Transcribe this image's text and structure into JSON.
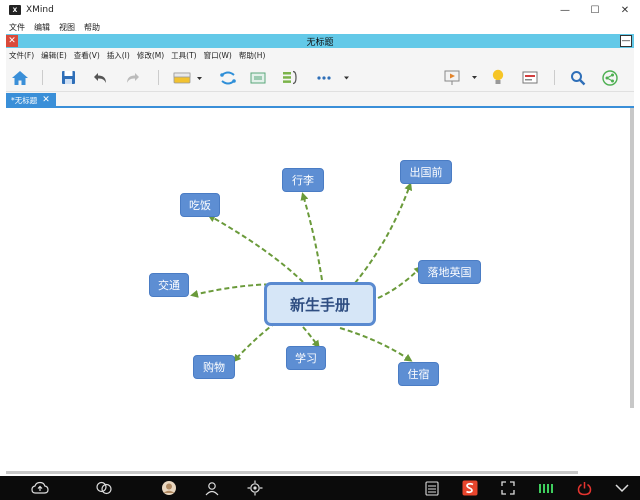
{
  "window": {
    "app_name": "XMind",
    "controls": {
      "minimize": "—",
      "maximize": "☐",
      "close": "✕"
    }
  },
  "outer_menu": [
    "文件",
    "编辑",
    "视图",
    "帮助"
  ],
  "inner_window": {
    "title": "无标题",
    "min_button": "—",
    "menu": [
      "文件(F)",
      "编辑(E)",
      "查看(V)",
      "插入(I)",
      "修改(M)",
      "工具(T)",
      "窗口(W)",
      "帮助(H)"
    ]
  },
  "toolbar": {
    "icons": [
      "home-icon",
      "save-icon",
      "undo-icon",
      "redo-icon",
      "topic-style-icon",
      "relationship-icon",
      "boundary-icon",
      "summary-icon",
      "more-icon",
      "presentation-icon",
      "idea-bulb-icon",
      "layout-panel-icon",
      "search-icon",
      "share-icon"
    ],
    "accent": "#3a8fd8"
  },
  "tabs": [
    {
      "label": "*无标题",
      "close": "✕"
    }
  ],
  "mindmap": {
    "central": "新生手册",
    "topics": [
      "出国前",
      "行李",
      "吃饭",
      "交通",
      "购物",
      "学习",
      "住宿",
      "落地英国"
    ],
    "topic_color": "#5d8ed3",
    "connector_color": "#6a9a3a"
  },
  "taskbar": {
    "icons": [
      "cloud-upload-icon",
      "chat-icon",
      "avatar-icon",
      "user-icon",
      "locate-icon",
      "keyboard-icon",
      "sogou-icon",
      "fullscreen-icon",
      "signal-icon",
      "power-icon",
      "chevron-down-icon"
    ]
  }
}
